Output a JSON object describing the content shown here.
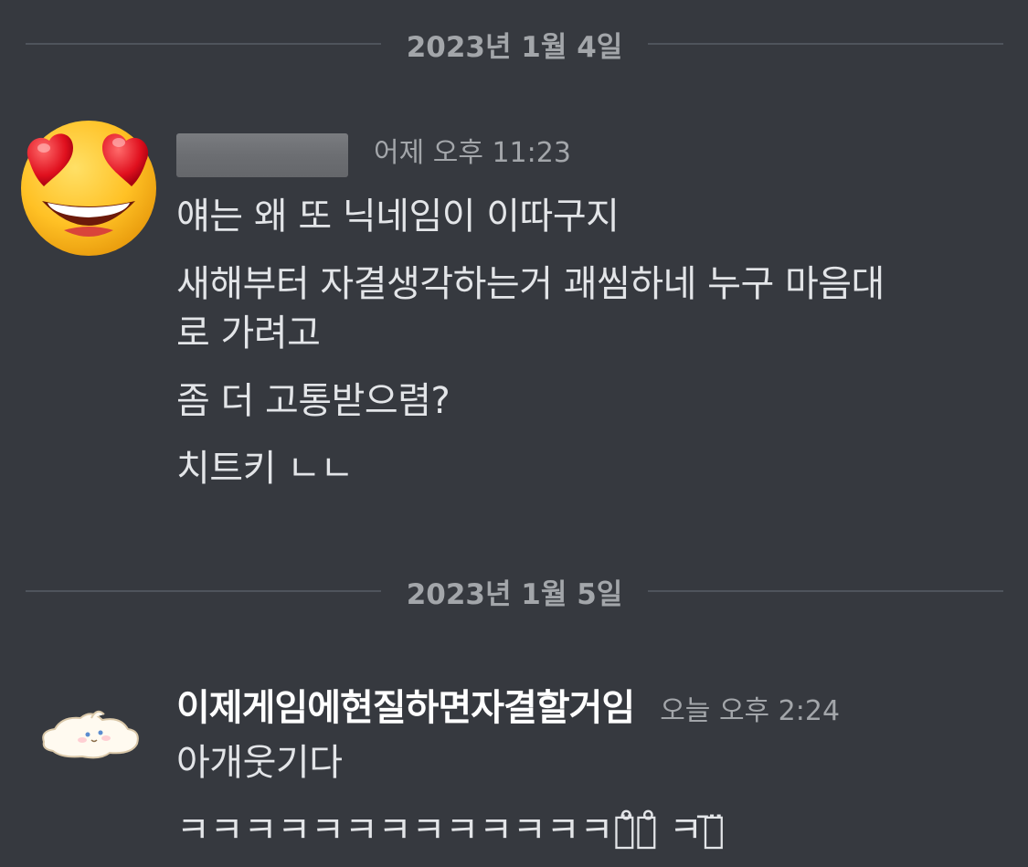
{
  "dividers": [
    {
      "date": "2023년 1월 4일"
    },
    {
      "date": "2023년 1월 5일"
    }
  ],
  "messages": [
    {
      "avatar_icon": "heart-eyes-emoji-icon",
      "username": "",
      "username_redacted": true,
      "timestamp": "어제 오후 11:23",
      "lines": [
        "얘는 왜 또 닉네임이 이따구지",
        "새해부터 자결생각하는거 괘씸하네 누구 마음대",
        "로 가려고",
        "좀 더 고통받으렴?",
        "치트키 ㄴㄴ"
      ]
    },
    {
      "avatar_icon": "lying-cat-icon",
      "username": "이제게임에현질하면자결할거임",
      "timestamp": "오늘 오후 2:24",
      "lines": [
        "아개웃기다",
        "ㅋㅋㅋㅋㅋㅋㅋㅋㅋㅋㅋㅋㅋㅋ̈̊ㅋ̊ ㅋ̄ㅋ̈"
      ]
    }
  ],
  "colors": {
    "background": "#36393f",
    "divider_line": "#4f545c",
    "muted_text": "#a3a6aa",
    "message_text": "#e3e5e8",
    "username_text": "#ffffff"
  }
}
